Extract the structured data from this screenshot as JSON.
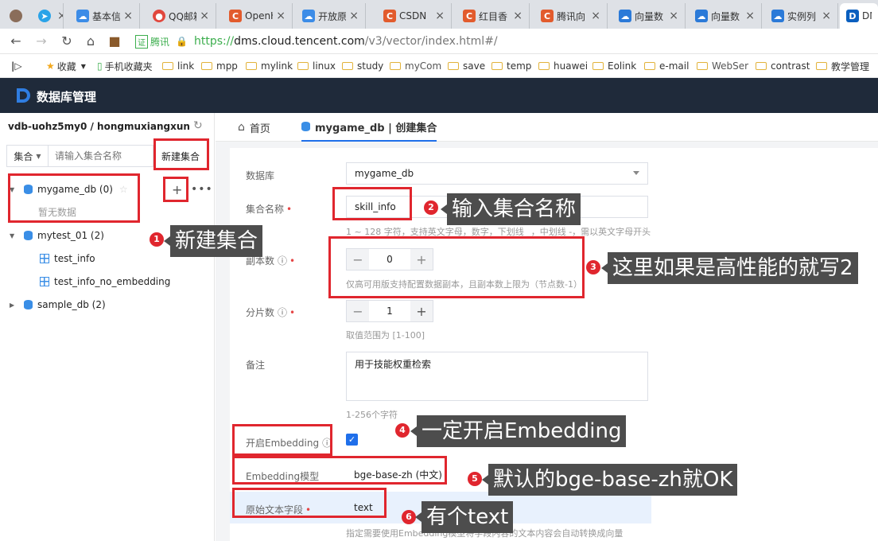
{
  "browser": {
    "tabs": [
      {
        "label": "",
        "icon": "avatar-icon",
        "color": "#8a6d5a"
      },
      {
        "label": "",
        "icon": "telegram-icon",
        "color": "#2aa3e8"
      },
      {
        "label": "基本信",
        "icon": "cloud-icon",
        "color": "#3c8ce7"
      },
      {
        "label": "QQ邮箱",
        "icon": "chrome-icon",
        "color": "#e1473d"
      },
      {
        "label": "OpenH",
        "icon": "c-icon",
        "color": "#e25b2d"
      },
      {
        "label": "开放原",
        "icon": "cloud-icon",
        "color": "#3c8ce7"
      },
      {
        "label": "CSDN",
        "icon": "c-icon",
        "color": "#e25b2d"
      },
      {
        "label": "红目香",
        "icon": "c-icon",
        "color": "#e25b2d"
      },
      {
        "label": "腾讯向",
        "icon": "c-icon",
        "color": "#e25b2d"
      },
      {
        "label": "向量数",
        "icon": "tcloud-icon",
        "color": "#2b7ad8"
      },
      {
        "label": "向量数",
        "icon": "tcloud-icon",
        "color": "#2b7ad8"
      },
      {
        "label": "实例列",
        "icon": "tcloud-icon",
        "color": "#2b7ad8"
      },
      {
        "label": "DM",
        "icon": "dms-icon",
        "color": "#0a5fbf"
      }
    ],
    "cert_label": "腾讯",
    "url_prefix": "https://",
    "url_host": "dms.cloud.tencent.com",
    "url_path": "/v3/vector/index.html#/",
    "bookmarks": [
      "收藏",
      "手机收藏夹",
      "link",
      "mpp",
      "mylink",
      "linux",
      "study",
      "myCom",
      "save",
      "temp",
      "huawei",
      "Eolink",
      "e-mail",
      "WebSer",
      "contrast",
      "教学管理"
    ]
  },
  "app": {
    "title": "数据库管理"
  },
  "sidebar": {
    "instance": "vdb-uohz5my0 / hongmuxiangxun",
    "filter_type": "集合",
    "search_placeholder": "请输入集合名称",
    "new_collection_label": "新建集合",
    "tree": [
      {
        "name": "mygame_db (0)",
        "expanded": true,
        "children_empty_label": "暂无数据"
      },
      {
        "name": "mytest_01 (2)",
        "expanded": true,
        "children": [
          "test_info",
          "test_info_no_embedding"
        ]
      },
      {
        "name": "sample_db (2)",
        "expanded": false
      }
    ]
  },
  "main": {
    "tabs": [
      "首页",
      "mygame_db | 创建集合"
    ],
    "form": {
      "database_label": "数据库",
      "database_value": "mygame_db",
      "collection_label": "集合名称",
      "collection_value": "skill_info",
      "collection_hint": "1 ~ 128 字符，支持英文字母，数字，下划线 _，中划线 -，需以英文字母开头",
      "replica_label": "副本数",
      "replica_value": "0",
      "replica_hint": "仅高可用版支持配置数据副本，且副本数上限为（节点数-1）",
      "shard_label": "分片数",
      "shard_value": "1",
      "shard_hint": "取值范围为 [1-100]",
      "remark_label": "备注",
      "remark_value": "用于技能权重检索",
      "remark_hint": "1-256个字符",
      "embedding_label": "开启Embedding",
      "embedding_enabled": true,
      "model_label": "Embedding模型",
      "model_value": "bge-base-zh (中文)",
      "field_label": "原始文本字段",
      "field_value": "text",
      "field_hint": "指定需要使用Embedding模型将字段内容的文本内容会自动转换成向量"
    }
  },
  "annotations": [
    {
      "num": "1",
      "text": "新建集合"
    },
    {
      "num": "2",
      "text": "输入集合名称"
    },
    {
      "num": "3",
      "text": "这里如果是高性能的就写2"
    },
    {
      "num": "4",
      "text": "一定开启Embedding"
    },
    {
      "num": "5",
      "text": "默认的bge-base-zh就OK"
    },
    {
      "num": "6",
      "text": "有个text"
    }
  ],
  "colors": {
    "annotation_red": "#e0262e",
    "callout_bg": "#4d4d4d",
    "header_bg": "#1f2a3a",
    "accent_blue": "#1f6fea",
    "model_row_bg": "#e8f1fd"
  }
}
